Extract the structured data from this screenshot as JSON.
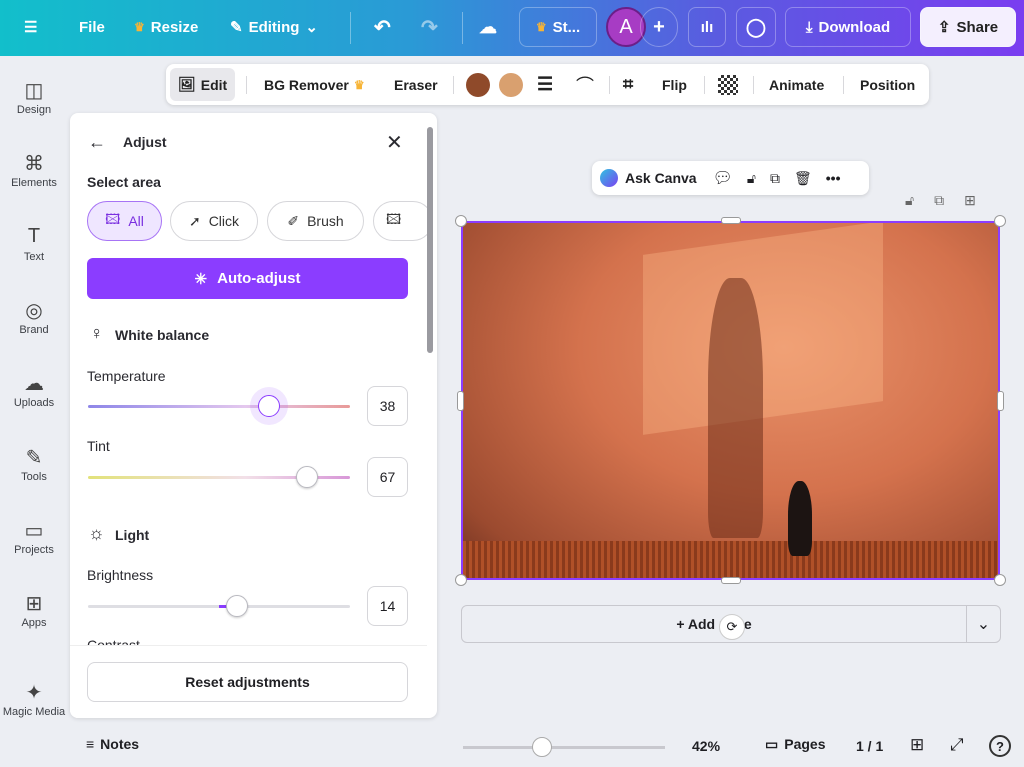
{
  "topbar": {
    "file": "File",
    "resize": "Resize",
    "editing": "Editing",
    "design_title": "St...",
    "avatar": "A",
    "download": "Download",
    "share": "Share"
  },
  "sidebar": {
    "items": [
      {
        "label": "Design",
        "icon": "◫"
      },
      {
        "label": "Elements",
        "icon": "⌘"
      },
      {
        "label": "Text",
        "icon": "T"
      },
      {
        "label": "Brand",
        "icon": "◎"
      },
      {
        "label": "Uploads",
        "icon": "☁"
      },
      {
        "label": "Tools",
        "icon": "✎"
      },
      {
        "label": "Projects",
        "icon": "▭"
      },
      {
        "label": "Apps",
        "icon": "⊞"
      },
      {
        "label": "Magic Media",
        "icon": "✦"
      }
    ]
  },
  "context_toolbar": {
    "edit": "Edit",
    "bg_remover": "BG Remover",
    "eraser": "Eraser",
    "color1": "#8f4a2a",
    "color2": "#d9a06f",
    "flip": "Flip",
    "animate": "Animate",
    "position": "Position"
  },
  "panel": {
    "title": "Adjust",
    "select_area": "Select area",
    "chips": [
      "All",
      "Click",
      "Brush"
    ],
    "auto_adjust": "Auto-adjust",
    "white_balance": "White balance",
    "temperature": {
      "label": "Temperature",
      "value": 38
    },
    "tint": {
      "label": "Tint",
      "value": 67
    },
    "light": "Light",
    "brightness": {
      "label": "Brightness",
      "value": 14
    },
    "contrast": "Contrast",
    "reset": "Reset adjustments",
    "slider_range": [
      -100,
      100
    ]
  },
  "floating": {
    "ask_canva": "Ask Canva"
  },
  "canvas": {
    "add_page": "+ Add page"
  },
  "bottom": {
    "notes": "Notes",
    "zoom": "42%",
    "pages": "Pages",
    "page_count": "1 / 1",
    "zoom_fraction": 0.39
  },
  "colors": {
    "accent": "#8b3dff"
  }
}
